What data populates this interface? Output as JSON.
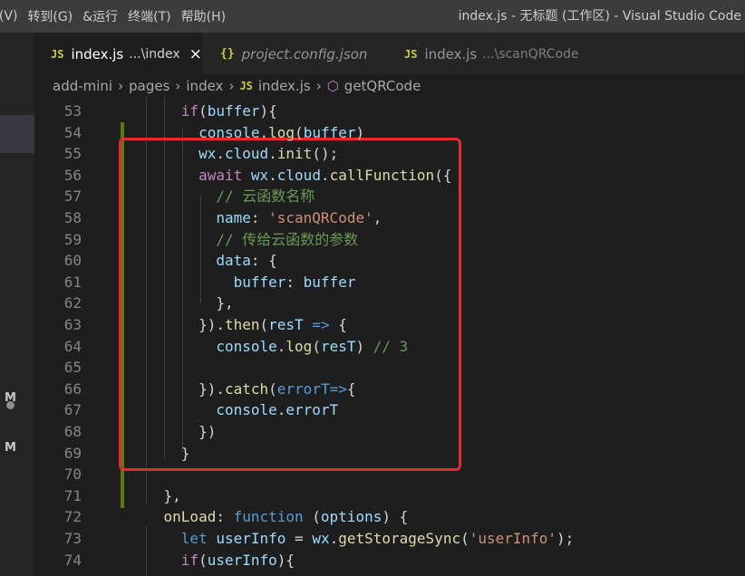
{
  "titlebar": {
    "menu": [
      "f(V)",
      "转到(G)",
      "&运行",
      "终端(T)",
      "帮助(H)"
    ],
    "window_title": "index.js - 无标题 (工作区) - Visual Studio Code"
  },
  "activity": {
    "badges": [
      "M",
      "M"
    ]
  },
  "tabs": [
    {
      "icon": "JS",
      "name": "index.js",
      "desc": "...\\index",
      "close": "×"
    },
    {
      "icon": "{}",
      "name": "project.config.json"
    },
    {
      "icon": "JS",
      "name": "index.js",
      "desc": "...\\scanQRCode"
    }
  ],
  "breadcrumb": {
    "segments": [
      "add-mini",
      "pages",
      "index"
    ],
    "file_icon": "JS",
    "file": "index.js",
    "symbol": "getQRCode"
  },
  "editor": {
    "line_numbers": [
      "53",
      "54",
      "55",
      "56",
      "57",
      "58",
      "59",
      "60",
      "61",
      "62",
      "63",
      "64",
      "65",
      "66",
      "67",
      "68",
      "69",
      "70",
      "71",
      "72",
      "73",
      "74"
    ],
    "lines": [
      {
        "indent": "      ",
        "tokens": [
          [
            "if",
            "kw"
          ],
          [
            "(",
            "pl"
          ],
          [
            "buffer",
            "var"
          ],
          [
            "){",
            "pl"
          ]
        ]
      },
      {
        "indent": "        ",
        "tokens": [
          [
            "console",
            "var"
          ],
          [
            ".",
            "pl"
          ],
          [
            "log",
            "fn"
          ],
          [
            "(",
            "pl"
          ],
          [
            "buffer",
            "var"
          ],
          [
            ")",
            "pl"
          ]
        ]
      },
      {
        "indent": "        ",
        "tokens": [
          [
            "wx",
            "var"
          ],
          [
            ".",
            "pl"
          ],
          [
            "cloud",
            "var"
          ],
          [
            ".",
            "pl"
          ],
          [
            "init",
            "fn"
          ],
          [
            "();",
            "pl"
          ]
        ]
      },
      {
        "indent": "        ",
        "tokens": [
          [
            "await",
            "kw"
          ],
          [
            " ",
            "pl"
          ],
          [
            "wx",
            "var"
          ],
          [
            ".",
            "pl"
          ],
          [
            "cloud",
            "var"
          ],
          [
            ".",
            "pl"
          ],
          [
            "callFunction",
            "fn"
          ],
          [
            "({",
            "pl"
          ]
        ]
      },
      {
        "indent": "          ",
        "tokens": [
          [
            "// 云函数名称",
            "com"
          ]
        ]
      },
      {
        "indent": "          ",
        "tokens": [
          [
            "name",
            "var"
          ],
          [
            ": ",
            "pl"
          ],
          [
            "'scanQRCode'",
            "str"
          ],
          [
            ",",
            "pl"
          ]
        ]
      },
      {
        "indent": "          ",
        "tokens": [
          [
            "// 传给云函数的参数",
            "com"
          ]
        ]
      },
      {
        "indent": "          ",
        "tokens": [
          [
            "data",
            "var"
          ],
          [
            ": {",
            "pl"
          ]
        ]
      },
      {
        "indent": "            ",
        "tokens": [
          [
            "buffer",
            "var"
          ],
          [
            ": ",
            "pl"
          ],
          [
            "buffer",
            "var"
          ]
        ]
      },
      {
        "indent": "          ",
        "tokens": [
          [
            "},",
            "pl"
          ]
        ]
      },
      {
        "indent": "        ",
        "tokens": [
          [
            "}).",
            "pl"
          ],
          [
            "then",
            "fn"
          ],
          [
            "(",
            "pl"
          ],
          [
            "resT",
            "var"
          ],
          [
            " => ",
            "st"
          ],
          [
            "{",
            "pl"
          ]
        ]
      },
      {
        "indent": "          ",
        "tokens": [
          [
            "console",
            "var"
          ],
          [
            ".",
            "pl"
          ],
          [
            "log",
            "fn"
          ],
          [
            "(",
            "pl"
          ],
          [
            "resT",
            "var"
          ],
          [
            ") ",
            "pl"
          ],
          [
            "// 3",
            "com"
          ]
        ]
      },
      {
        "indent": "",
        "tokens": []
      },
      {
        "indent": "        ",
        "tokens": [
          [
            "}).",
            "pl"
          ],
          [
            "catch",
            "fn"
          ],
          [
            "(",
            "pl"
          ],
          [
            "errorT=>",
            "st"
          ],
          [
            "{",
            "pl"
          ]
        ]
      },
      {
        "indent": "          ",
        "tokens": [
          [
            "console",
            "var"
          ],
          [
            ".",
            "pl"
          ],
          [
            "errorT",
            "var"
          ]
        ]
      },
      {
        "indent": "        ",
        "tokens": [
          [
            "})",
            "pl"
          ]
        ]
      },
      {
        "indent": "      ",
        "tokens": [
          [
            "}",
            "pl"
          ]
        ]
      },
      {
        "indent": "",
        "tokens": []
      },
      {
        "indent": "    ",
        "tokens": [
          [
            "},",
            "pl"
          ]
        ]
      },
      {
        "indent": "    ",
        "tokens": [
          [
            "onLoad",
            "fn"
          ],
          [
            ": ",
            "pl"
          ],
          [
            "function",
            "st"
          ],
          [
            " (",
            "pl"
          ],
          [
            "options",
            "var"
          ],
          [
            ") {",
            "pl"
          ]
        ]
      },
      {
        "indent": "      ",
        "tokens": [
          [
            "let",
            "st"
          ],
          [
            " ",
            "pl"
          ],
          [
            "userInfo",
            "var"
          ],
          [
            " = ",
            "pl"
          ],
          [
            "wx",
            "var"
          ],
          [
            ".",
            "pl"
          ],
          [
            "getStorageSync",
            "fn"
          ],
          [
            "(",
            "pl"
          ],
          [
            "'userInfo'",
            "str"
          ],
          [
            ");",
            "pl"
          ]
        ]
      },
      {
        "indent": "      ",
        "tokens": [
          [
            "if",
            "kw"
          ],
          [
            "(",
            "pl"
          ],
          [
            "userInfo",
            "var"
          ],
          [
            "){",
            "pl"
          ]
        ]
      }
    ]
  },
  "colors": {
    "highlight_border": "#e22b2b",
    "gutter_modified": "#587c0c"
  }
}
